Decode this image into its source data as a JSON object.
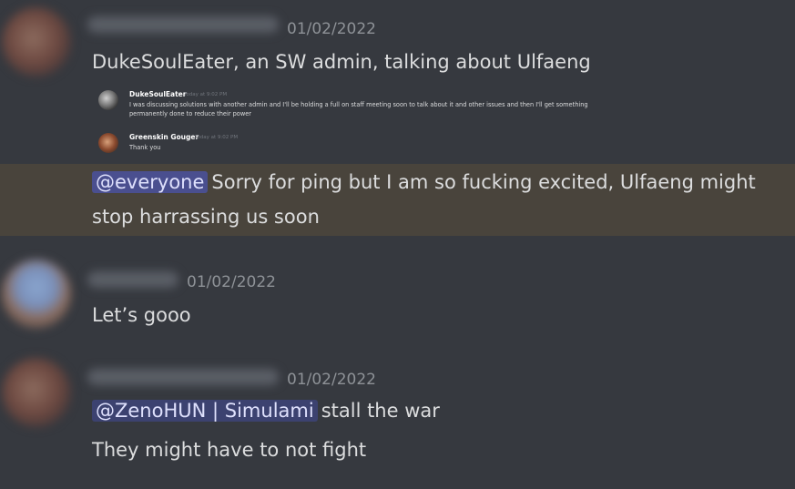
{
  "messages": [
    {
      "timestamp": "01/02/2022",
      "lines": [
        "DukeSoulEater, an SW admin, talking about Ulfaeng"
      ],
      "embed": {
        "entries": [
          {
            "name": "DukeSoulEater",
            "time": "Today at 9:02 PM",
            "text_line1": "I was discussing solutions with another admin and I'll be holding a full on staff meeting soon to talk about it and other issues and then I'll get something",
            "text_line2": "permanently done to reduce their power"
          },
          {
            "name": "Greenskin Gouger",
            "time": "Today at 9:02 PM",
            "text_line1": "Thank you"
          }
        ]
      }
    },
    {
      "mention": "@everyone",
      "line1_rest": "Sorry for ping but I am so fucking excited, Ulfaeng might",
      "line2": "stop harrassing us soon",
      "highlight_color": "#49443c"
    },
    {
      "timestamp": "01/02/2022",
      "lines": [
        "Let’s gooo"
      ]
    },
    {
      "timestamp": "01/02/2022",
      "mention": "@ZenoHUN | Simulami",
      "line1_rest": "stall the war",
      "line2": "They might have to not fight"
    }
  ],
  "colors": {
    "background": "#36393f",
    "text": "#dcddde",
    "timestamp": "#8e9297",
    "mention_pill": "#4a4f8f"
  }
}
